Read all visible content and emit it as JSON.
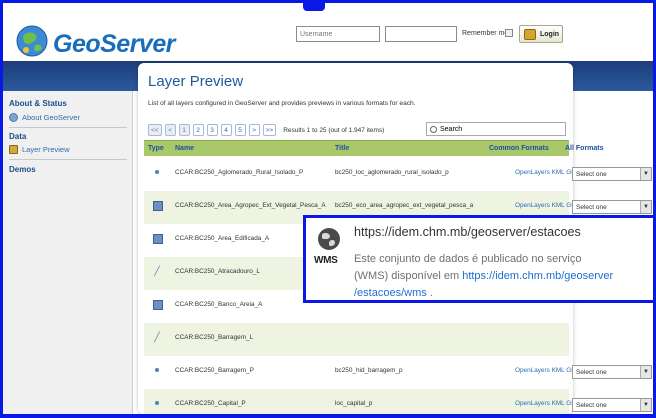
{
  "header": {
    "brand": "GeoServer",
    "username_placeholder": "Username",
    "password_placeholder": "",
    "remember_label": "Remember me",
    "login_label": "Login"
  },
  "sidebar": {
    "section_about": "About & Status",
    "item_about": "About GeoServer",
    "section_data": "Data",
    "item_preview": "Layer Preview",
    "section_demos": "Demos"
  },
  "main": {
    "title": "Layer Preview",
    "description": "List of all layers configured in GeoServer and provides previews in various formats for each.",
    "pager": {
      "first": "<<",
      "prev": "<",
      "pages": [
        "1",
        "2",
        "3",
        "4",
        "5"
      ],
      "next": ">",
      "last": ">>",
      "results": "Results 1 to 25 (out of 1.947 items)"
    },
    "search_placeholder": "Search",
    "columns": {
      "type": "Type",
      "name": "Name",
      "title": "Title",
      "common_formats": "Common Formats",
      "all_formats": "All Formats"
    },
    "rows": [
      {
        "type": "point",
        "name": "CCAR:BC250_Aglomerado_Rural_Isolado_P",
        "title": "bc250_loc_aglomerado_rural_isolado_p",
        "formats": "OpenLayers KML GML",
        "select": "Select one"
      },
      {
        "type": "polygon",
        "name": "CCAR:BC250_Area_Agropec_Ext_Vegetal_Pesca_A",
        "title": "bc250_eco_area_agropec_ext_vegetal_pesca_a",
        "formats": "OpenLayers KML GML",
        "select": "Select one"
      },
      {
        "type": "polygon",
        "name": "CCAR:BC250_Area_Edificada_A",
        "title": "",
        "formats": "",
        "select": ""
      },
      {
        "type": "line",
        "name": "CCAR:BC250_Atracadouro_L",
        "title": "",
        "formats": "",
        "select": ""
      },
      {
        "type": "polygon",
        "name": "CCAR:BC250_Banco_Areia_A",
        "title": "",
        "formats": "",
        "select": ""
      },
      {
        "type": "line",
        "name": "CCAR:BC250_Barragem_L",
        "title": "",
        "formats": "",
        "select": ""
      },
      {
        "type": "point",
        "name": "CCAR:BC250_Barragem_P",
        "title": "bc250_hid_barragem_p",
        "formats": "OpenLayers KML GML",
        "select": "Select one"
      },
      {
        "type": "point",
        "name": "CCAR:BC250_Capital_P",
        "title": "loc_capital_p",
        "formats": "OpenLayers KML GML",
        "select": "Select one"
      }
    ]
  },
  "popup": {
    "badge": "WMS",
    "url": "https://idem.chm.mb/geoserver/estacoes",
    "desc_line1": "Este conjunto de dados é publicado no serviço",
    "desc_line2_prefix": "(WMS) disponível em ",
    "desc_line2_link": "https://idem.chm.mb/geoserver",
    "desc_line3_link": "/estacoes/wms",
    "desc_line3_suffix": " ."
  },
  "colors": {
    "frame_blue": "#0a18e6",
    "brand_blue": "#1a6dbb",
    "table_header_green": "#a8c86a",
    "link_blue": "#2c6db3"
  }
}
